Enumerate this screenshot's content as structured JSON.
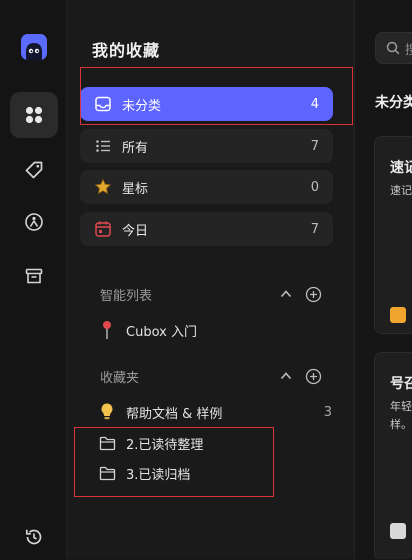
{
  "sidebar_panel": {
    "title": "我的收藏",
    "filters": [
      {
        "label": "未分类",
        "count": "4",
        "icon": "inbox-icon",
        "active": true
      },
      {
        "label": "所有",
        "count": "7",
        "icon": "list-icon"
      },
      {
        "label": "星标",
        "count": "0",
        "icon": "star-icon"
      },
      {
        "label": "今日",
        "count": "7",
        "icon": "calendar-icon"
      }
    ],
    "smart_lists": {
      "label": "智能列表",
      "items": [
        {
          "label": "Cubox 入门",
          "icon": "pin-icon"
        }
      ]
    },
    "folders": {
      "label": "收藏夹",
      "items": [
        {
          "label": "帮助文档 & 样例",
          "count": "3",
          "icon": "lightbulb-icon"
        },
        {
          "label": "2.已读待整理",
          "icon": "folder-icon"
        },
        {
          "label": "3.已读归档",
          "icon": "folder-icon"
        }
      ]
    }
  },
  "content": {
    "search_placeholder": "搜",
    "title": "未分类",
    "cards": [
      {
        "title": "速记",
        "subtitle": "速记"
      },
      {
        "title": "号召",
        "subtitle": "年轻人 样。"
      }
    ]
  },
  "colors": {
    "accent": "#5d64ff",
    "highlight_box": "#d9343a",
    "star": "#e2a72e",
    "calendar": "#e0484e",
    "pin": "#e0484e",
    "bulb": "#f2c14e"
  }
}
